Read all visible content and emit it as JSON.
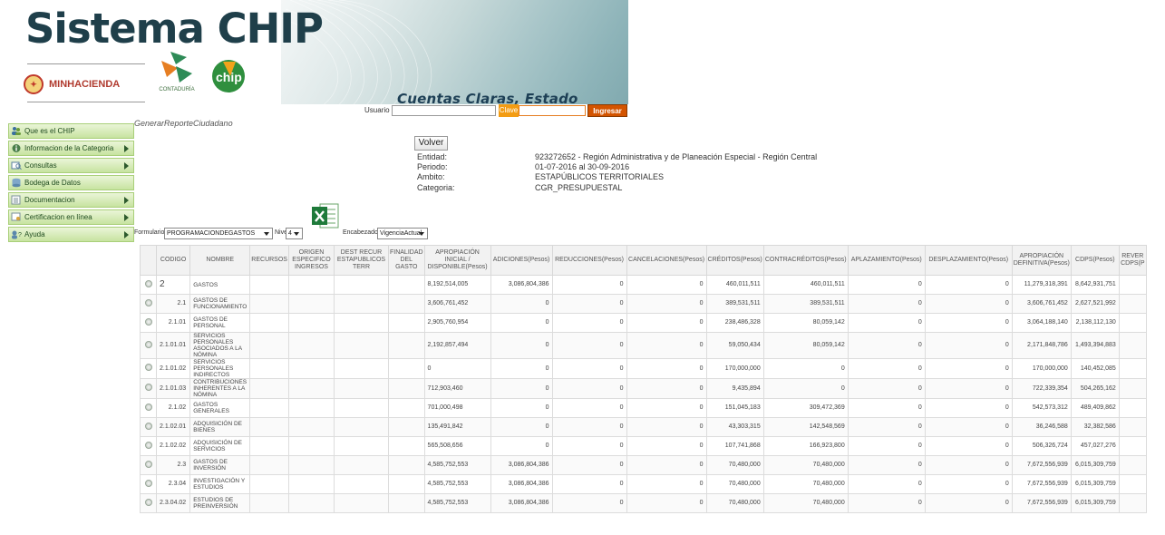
{
  "header": {
    "title": "Sistema CHIP",
    "minhacienda": "MINHACIENDA",
    "contaduria": "CONTADURÍA",
    "chip_logo_text": "chip",
    "slogan": "Cuentas Claras, Estado Transparente",
    "login": {
      "user_label": "Usuario",
      "pass_label": "Clave",
      "button_label": "Ingresar"
    }
  },
  "sidebar": {
    "items": [
      {
        "label": "Que es el CHIP",
        "icon": "people-icon",
        "has_submenu": false
      },
      {
        "label": "Informacion de la Categoria",
        "icon": "info-icon",
        "has_submenu": true
      },
      {
        "label": "Consultas",
        "icon": "search-icon",
        "has_submenu": true
      },
      {
        "label": "Bodega de Datos",
        "icon": "database-icon",
        "has_submenu": false
      },
      {
        "label": "Documentacion",
        "icon": "document-icon",
        "has_submenu": true
      },
      {
        "label": "Certificacion en línea",
        "icon": "certificate-icon",
        "has_submenu": true
      },
      {
        "label": "Ayuda",
        "icon": "help-icon",
        "has_submenu": true
      }
    ]
  },
  "main": {
    "breadcrumb": "GenerarReporteCiudadano",
    "volver_label": "Volver",
    "info": [
      {
        "key": "Entidad:",
        "value": "923272652 - Región Administrativa y de Planeación Especial - Región Central"
      },
      {
        "key": "Periodo:",
        "value": "01-07-2016 al 30-09-2016"
      },
      {
        "key": "Ambito:",
        "value": "ESTAPÚBLICOS TERRITORIALES"
      },
      {
        "key": "Categoria:",
        "value": "CGR_PRESUPUESTAL"
      }
    ],
    "filters": {
      "formulario_label": "Formulario",
      "formulario_value": "PROGRAMACIONDEGASTOS",
      "nivel_label": "Nivel",
      "nivel_value": "4",
      "encabezado_label": "Encabezado",
      "encabezado_value": "VigenciaActual"
    }
  },
  "table": {
    "columns": [
      "",
      "CODIGO",
      "NOMBRE",
      "RECURSOS",
      "ORIGEN ESPECIFICO INGRESOS",
      "DEST RECUR ESTAPUBLICOS TERR",
      "FINALIDAD DEL GASTO",
      "APROPIACIÓN INICIAL / DISPONIBLE(Pesos)",
      "ADICIONES(Pesos)",
      "REDUCCIONES(Pesos)",
      "CANCELACIONES(Pesos)",
      "CRÉDITOS(Pesos)",
      "CONTRACRÉDITOS(Pesos)",
      "APLAZAMIENTO(Pesos)",
      "DESPLAZAMIENTO(Pesos)",
      "APROPIACIÓN DEFINITIVA(Pesos)",
      "CDPS(Pesos)",
      "REVER CDPS(P"
    ],
    "rows": [
      {
        "codigo": "2",
        "nombre": "GASTOS",
        "apropiacion": "8,192,514,005",
        "adiciones": "3,086,804,386",
        "reducciones": "0",
        "cancelaciones": "0",
        "creditos": "460,011,511",
        "contracreditos": "460,011,511",
        "aplazamiento": "0",
        "desplazamiento": "0",
        "definitiva": "11,279,318,391",
        "cdps": "8,642,931,751"
      },
      {
        "codigo": "2.1",
        "nombre": "GASTOS DE FUNCIONAMIENTO",
        "apropiacion": "3,606,761,452",
        "adiciones": "0",
        "reducciones": "0",
        "cancelaciones": "0",
        "creditos": "389,531,511",
        "contracreditos": "389,531,511",
        "aplazamiento": "0",
        "desplazamiento": "0",
        "definitiva": "3,606,761,452",
        "cdps": "2,627,521,992"
      },
      {
        "codigo": "2.1.01",
        "nombre": "GASTOS DE PERSONAL",
        "apropiacion": "2,905,760,954",
        "adiciones": "0",
        "reducciones": "0",
        "cancelaciones": "0",
        "creditos": "238,486,328",
        "contracreditos": "80,059,142",
        "aplazamiento": "0",
        "desplazamiento": "0",
        "definitiva": "3,064,188,140",
        "cdps": "2,138,112,130"
      },
      {
        "codigo": "2.1.01.01",
        "nombre": "SERVICIOS PERSONALES ASOCIADOS A LA NÓMINA",
        "apropiacion": "2,192,857,494",
        "adiciones": "0",
        "reducciones": "0",
        "cancelaciones": "0",
        "creditos": "59,050,434",
        "contracreditos": "80,059,142",
        "aplazamiento": "0",
        "desplazamiento": "0",
        "definitiva": "2,171,848,786",
        "cdps": "1,493,394,883"
      },
      {
        "codigo": "2.1.01.02",
        "nombre": "SERVICIOS PERSONALES INDIRECTOS",
        "apropiacion": "0",
        "adiciones": "0",
        "reducciones": "0",
        "cancelaciones": "0",
        "creditos": "170,000,000",
        "contracreditos": "0",
        "aplazamiento": "0",
        "desplazamiento": "0",
        "definitiva": "170,000,000",
        "cdps": "140,452,085"
      },
      {
        "codigo": "2.1.01.03",
        "nombre": "CONTRIBUCIONES INHERENTES A LA NÓMINA",
        "apropiacion": "712,903,460",
        "adiciones": "0",
        "reducciones": "0",
        "cancelaciones": "0",
        "creditos": "9,435,894",
        "contracreditos": "0",
        "aplazamiento": "0",
        "desplazamiento": "0",
        "definitiva": "722,339,354",
        "cdps": "504,265,162"
      },
      {
        "codigo": "2.1.02",
        "nombre": "GASTOS GENERALES",
        "apropiacion": "701,000,498",
        "adiciones": "0",
        "reducciones": "0",
        "cancelaciones": "0",
        "creditos": "151,045,183",
        "contracreditos": "309,472,369",
        "aplazamiento": "0",
        "desplazamiento": "0",
        "definitiva": "542,573,312",
        "cdps": "489,409,862"
      },
      {
        "codigo": "2.1.02.01",
        "nombre": "ADQUISICIÓN DE BIENES",
        "apropiacion": "135,491,842",
        "adiciones": "0",
        "reducciones": "0",
        "cancelaciones": "0",
        "creditos": "43,303,315",
        "contracreditos": "142,548,569",
        "aplazamiento": "0",
        "desplazamiento": "0",
        "definitiva": "36,246,588",
        "cdps": "32,382,586"
      },
      {
        "codigo": "2.1.02.02",
        "nombre": "ADQUISICIÓN DE SERVICIOS",
        "apropiacion": "565,508,656",
        "adiciones": "0",
        "reducciones": "0",
        "cancelaciones": "0",
        "creditos": "107,741,868",
        "contracreditos": "166,923,800",
        "aplazamiento": "0",
        "desplazamiento": "0",
        "definitiva": "506,326,724",
        "cdps": "457,027,276"
      },
      {
        "codigo": "2.3",
        "nombre": "GASTOS DE INVERSIÓN",
        "apropiacion": "4,585,752,553",
        "adiciones": "3,086,804,386",
        "reducciones": "0",
        "cancelaciones": "0",
        "creditos": "70,480,000",
        "contracreditos": "70,480,000",
        "aplazamiento": "0",
        "desplazamiento": "0",
        "definitiva": "7,672,556,939",
        "cdps": "6,015,309,759"
      },
      {
        "codigo": "2.3.04",
        "nombre": "INVESTIGACIÓN Y ESTUDIOS",
        "apropiacion": "4,585,752,553",
        "adiciones": "3,086,804,386",
        "reducciones": "0",
        "cancelaciones": "0",
        "creditos": "70,480,000",
        "contracreditos": "70,480,000",
        "aplazamiento": "0",
        "desplazamiento": "0",
        "definitiva": "7,672,556,939",
        "cdps": "6,015,309,759"
      },
      {
        "codigo": "2.3.04.02",
        "nombre": "ESTUDIOS DE PREINVERSIÓN",
        "apropiacion": "4,585,752,553",
        "adiciones": "3,086,804,386",
        "reducciones": "0",
        "cancelaciones": "0",
        "creditos": "70,480,000",
        "contracreditos": "70,480,000",
        "aplazamiento": "0",
        "desplazamiento": "0",
        "definitiva": "7,672,556,939",
        "cdps": "6,015,309,759"
      }
    ]
  },
  "colors": {
    "sidebar_bg": "#c7e3a0",
    "login_button": "#d35400",
    "pass_label": "#f39c12",
    "title": "#1f3f4a"
  }
}
